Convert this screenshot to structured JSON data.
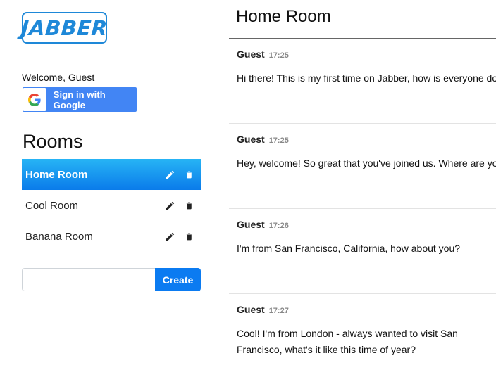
{
  "app": {
    "logo_text": "JABBER",
    "brand_color": "#1e88d8"
  },
  "user": {
    "welcome": "Welcome, Guest",
    "google_signin_label": "Sign in with Google"
  },
  "rooms": {
    "title": "Rooms",
    "items": [
      {
        "name": "Home Room",
        "active": true
      },
      {
        "name": "Cool Room",
        "active": false
      },
      {
        "name": "Banana Room",
        "active": false
      }
    ],
    "create_input_value": "",
    "create_input_placeholder": "",
    "create_label": "Create"
  },
  "chat": {
    "room_title": "Home Room",
    "messages": [
      {
        "author": "Guest",
        "time": "17:25",
        "text": "Hi there! This is my first time on Jabber, how is everyone doing today?"
      },
      {
        "author": "Guest",
        "time": "17:25",
        "text": "Hey, welcome! So great that you've joined us. Where are you from?"
      },
      {
        "author": "Guest",
        "time": "17:26",
        "text": "I'm from San Francisco, California, how about you?"
      },
      {
        "author": "Guest",
        "time": "17:27",
        "text": "Cool! I'm from London - always wanted to visit San Francisco, what's it like this time of year?"
      }
    ]
  },
  "colors": {
    "active_room_top": "#27b4f5",
    "active_room_bottom": "#0a7bea",
    "google_blue": "#4285f4",
    "create_button": "#0b7bf1"
  },
  "icons": {
    "edit": "pencil-icon",
    "delete": "trash-icon",
    "google": "google-g-icon"
  }
}
